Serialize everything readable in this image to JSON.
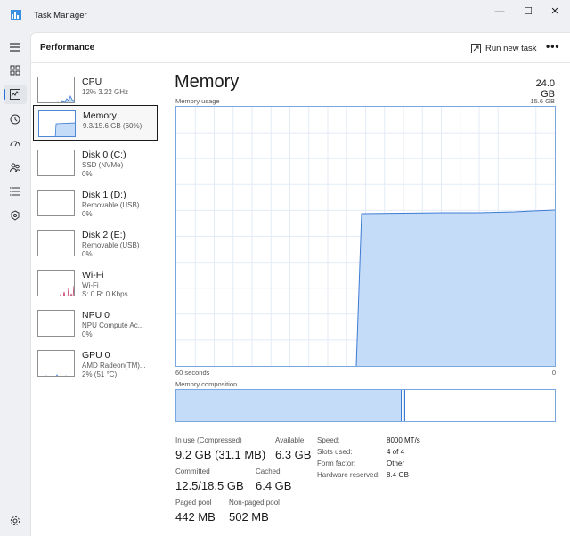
{
  "app": {
    "title": "Task Manager"
  },
  "window": {
    "minimize": "—",
    "maximize": "☐",
    "close": "✕"
  },
  "header": {
    "page_title": "Performance",
    "run_new_task": "Run new task",
    "more": "•••"
  },
  "devices": [
    {
      "name": "CPU",
      "sub": "12%  3.22 GHz",
      "sub2": ""
    },
    {
      "name": "Memory",
      "sub": "9.3/15.6 GB (60%)",
      "sub2": ""
    },
    {
      "name": "Disk 0 (C:)",
      "sub": "SSD (NVMe)",
      "sub2": "0%"
    },
    {
      "name": "Disk 1 (D:)",
      "sub": "Removable (USB)",
      "sub2": "0%"
    },
    {
      "name": "Disk 2 (E:)",
      "sub": "Removable (USB)",
      "sub2": "0%"
    },
    {
      "name": "Wi-Fi",
      "sub": "Wi-Fi",
      "sub2": "S: 0  R: 0 Kbps"
    },
    {
      "name": "NPU 0",
      "sub": "NPU Compute Ac...",
      "sub2": "0%"
    },
    {
      "name": "GPU 0",
      "sub": "AMD Radeon(TM)...",
      "sub2": "2% (51 °C)"
    }
  ],
  "memory": {
    "title": "Memory",
    "total": "24.0 GB",
    "usage_label": "Memory usage",
    "usage_max": "15.6 GB",
    "time_left": "60 seconds",
    "time_right": "0",
    "composition_label": "Memory composition",
    "composition_in_use_fraction": 0.595,
    "stats": {
      "in_use_label": "In use (Compressed)",
      "in_use_value": "9.2 GB (31.1 MB)",
      "available_label": "Available",
      "available_value": "6.3 GB",
      "committed_label": "Committed",
      "committed_value": "12.5/18.5 GB",
      "cached_label": "Cached",
      "cached_value": "6.4 GB",
      "paged_label": "Paged pool",
      "paged_value": "442 MB",
      "nonpaged_label": "Non-paged pool",
      "nonpaged_value": "502 MB"
    },
    "details": {
      "speed_label": "Speed:",
      "speed_value": "8000 MT/s",
      "slots_label": "Slots used:",
      "slots_value": "4 of 4",
      "form_label": "Form factor:",
      "form_value": "Other",
      "reserved_label": "Hardware reserved:",
      "reserved_value": "8.4 GB"
    }
  },
  "colors": {
    "accent": "#2a6fd6",
    "graph_fill": "#c5dcf8",
    "graph_line": "#3d7bd4"
  }
}
